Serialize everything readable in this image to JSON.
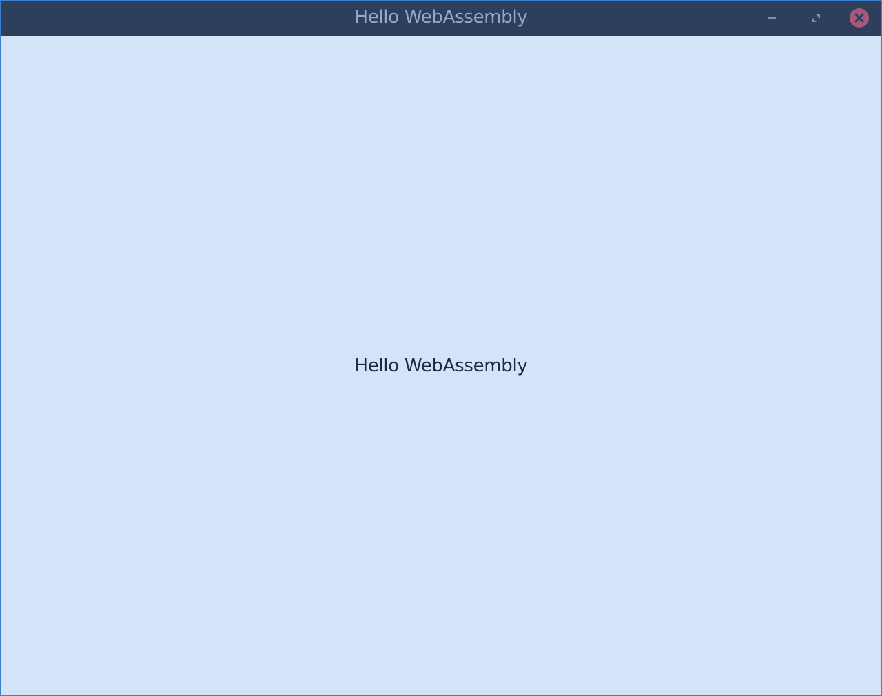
{
  "window": {
    "title": "Hello WebAssembly",
    "controls": {
      "minimize_icon": "minimize-icon",
      "maximize_icon": "restore-icon",
      "close_icon": "close-icon"
    }
  },
  "content": {
    "label": "Hello WebAssembly"
  },
  "colors": {
    "titlebar": "#2e3f5c",
    "title_text": "#93a9c8",
    "background": "#d3e4f8",
    "border": "#3a7fd0",
    "label_text": "#1a2a48",
    "close_button": "#a8587a"
  }
}
